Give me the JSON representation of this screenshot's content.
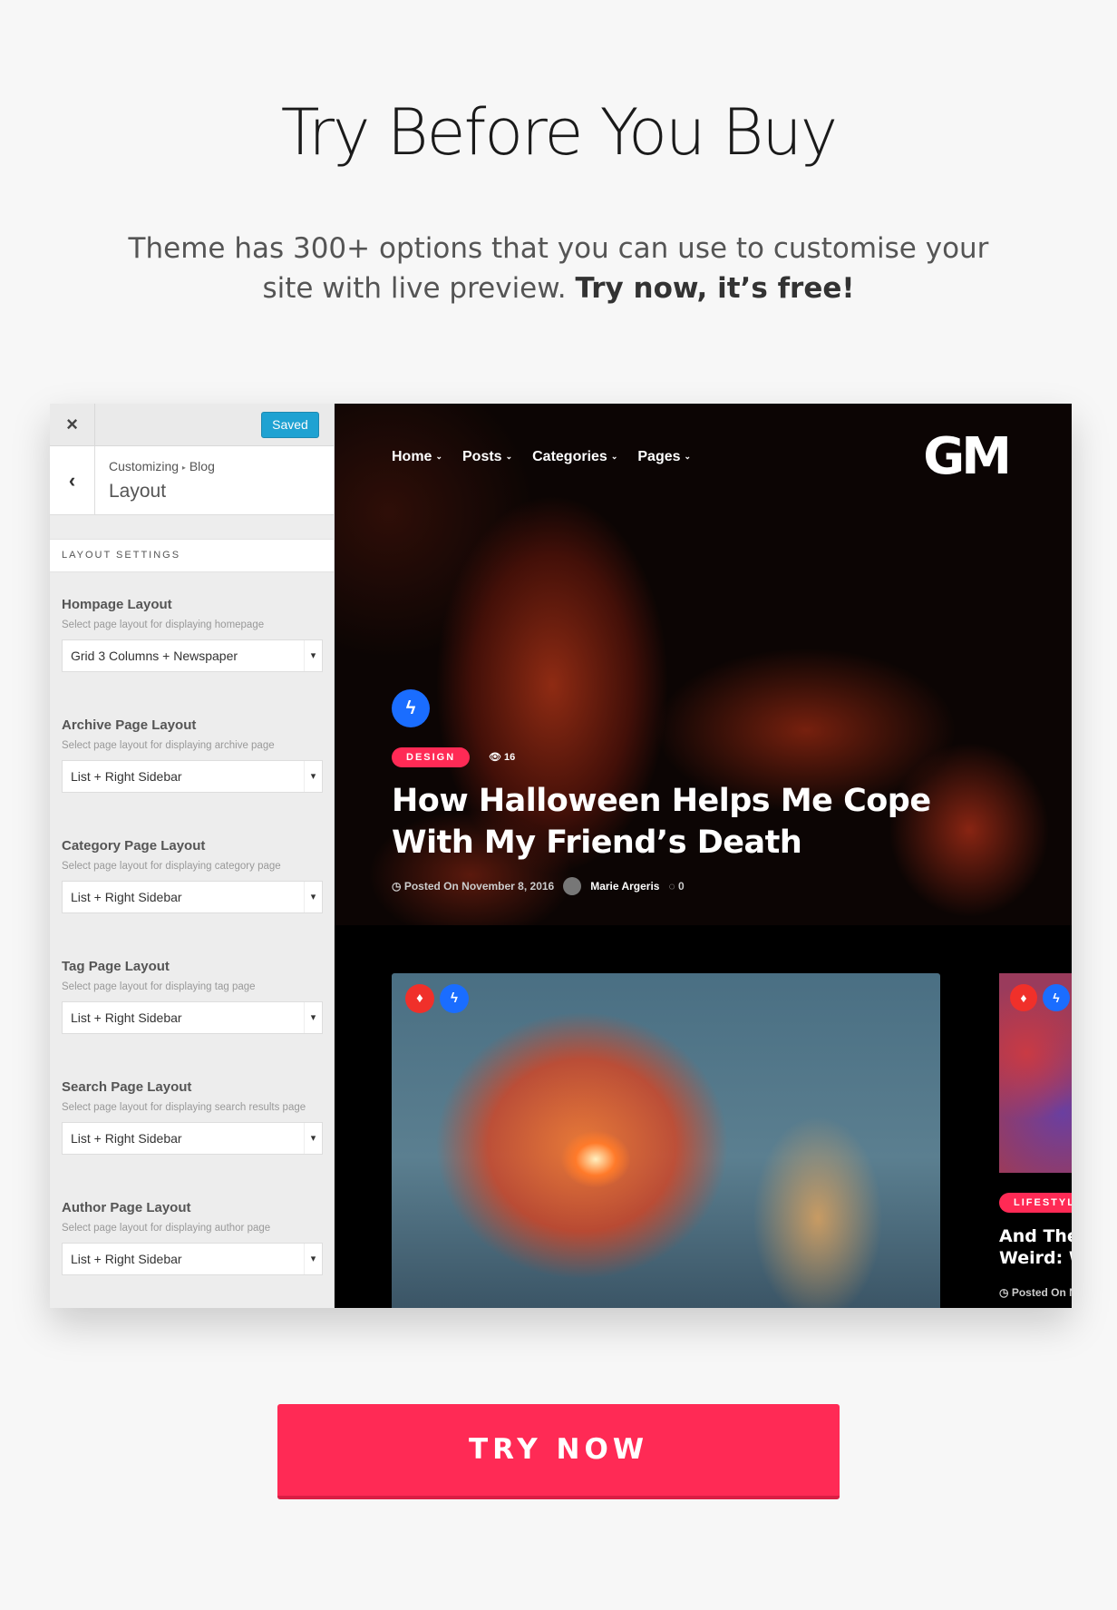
{
  "hero": {
    "title": "Try Before You Buy",
    "subtitle": "Theme has 300+ options that you can use to customise your site with live preview.",
    "subtitle_bold": "Try now, it’s free!"
  },
  "customizer": {
    "close_icon": "×",
    "saved_label": "Saved",
    "back_icon": "‹",
    "breadcrumb_root": "Customizing",
    "breadcrumb_sep": "▸",
    "breadcrumb_leaf": "Blog",
    "page_title": "Layout",
    "section_title": "LAYOUT SETTINGS",
    "fields": [
      {
        "label": "Hompage Layout",
        "desc": "Select page layout for displaying homepage",
        "value": "Grid 3 Columns + Newspaper"
      },
      {
        "label": "Archive Page Layout",
        "desc": "Select page layout for displaying archive page",
        "value": "List + Right Sidebar"
      },
      {
        "label": "Category Page Layout",
        "desc": "Select page layout for displaying category page",
        "value": "List + Right Sidebar"
      },
      {
        "label": "Tag Page Layout",
        "desc": "Select page layout for displaying tag page",
        "value": "List + Right Sidebar"
      },
      {
        "label": "Search Page Layout",
        "desc": "Select page layout for displaying search results page",
        "value": "List + Right Sidebar"
      },
      {
        "label": "Author Page Layout",
        "desc": "Select page layout for displaying author page",
        "value": "List + Right Sidebar"
      }
    ]
  },
  "preview": {
    "nav": [
      "Home",
      "Posts",
      "Categories",
      "Pages"
    ],
    "logo": "GM",
    "featured": {
      "tag": "DESIGN",
      "views": "16",
      "title": "How Halloween Helps Me Cope With My Friend’s Death",
      "posted": "Posted On November 8, 2016",
      "author": "Marie Argeris",
      "comments": "0"
    },
    "side_post": {
      "tag": "LIFESTYLE",
      "title_line1": "And Then A",
      "title_line2": "Weird: Wh",
      "posted": "Posted On No"
    }
  },
  "cta": {
    "label": "TRY NOW"
  },
  "colors": {
    "accent": "#ff2a55",
    "saved": "#0a9bd0",
    "bolt": "#1a6dff"
  },
  "icons": {
    "bolt": "bolt-icon",
    "fire": "fire-icon",
    "eye": "eye-icon",
    "clock": "clock-icon",
    "comment": "comment-icon"
  }
}
